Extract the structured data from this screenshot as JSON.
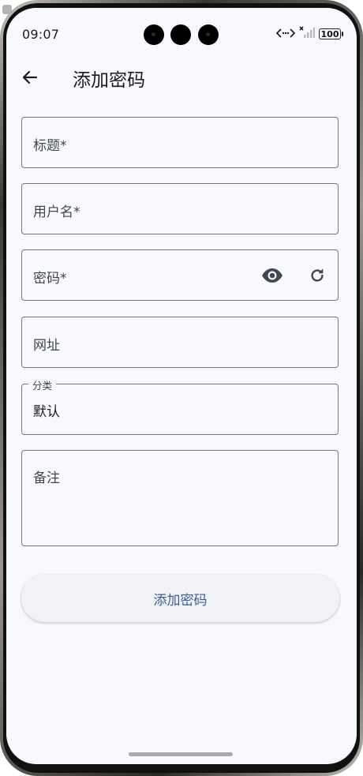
{
  "status_bar": {
    "time": "09:07",
    "battery": "100"
  },
  "app_bar": {
    "title": "添加密码"
  },
  "form": {
    "title_label": "标题*",
    "username_label": "用户名*",
    "password_label": "密码*",
    "url_label": "网址",
    "category_label": "分类",
    "category_value": "默认",
    "notes_label": "备注"
  },
  "submit": {
    "label": "添加密码"
  },
  "colors": {
    "background": "#f7f9fe",
    "accent_text": "#3a5f94",
    "outline": "#76777b"
  },
  "icons": [
    "back-arrow-icon",
    "eye-icon",
    "refresh-icon",
    "battery-icon",
    "signal-icon",
    "data-transfer-icon"
  ]
}
